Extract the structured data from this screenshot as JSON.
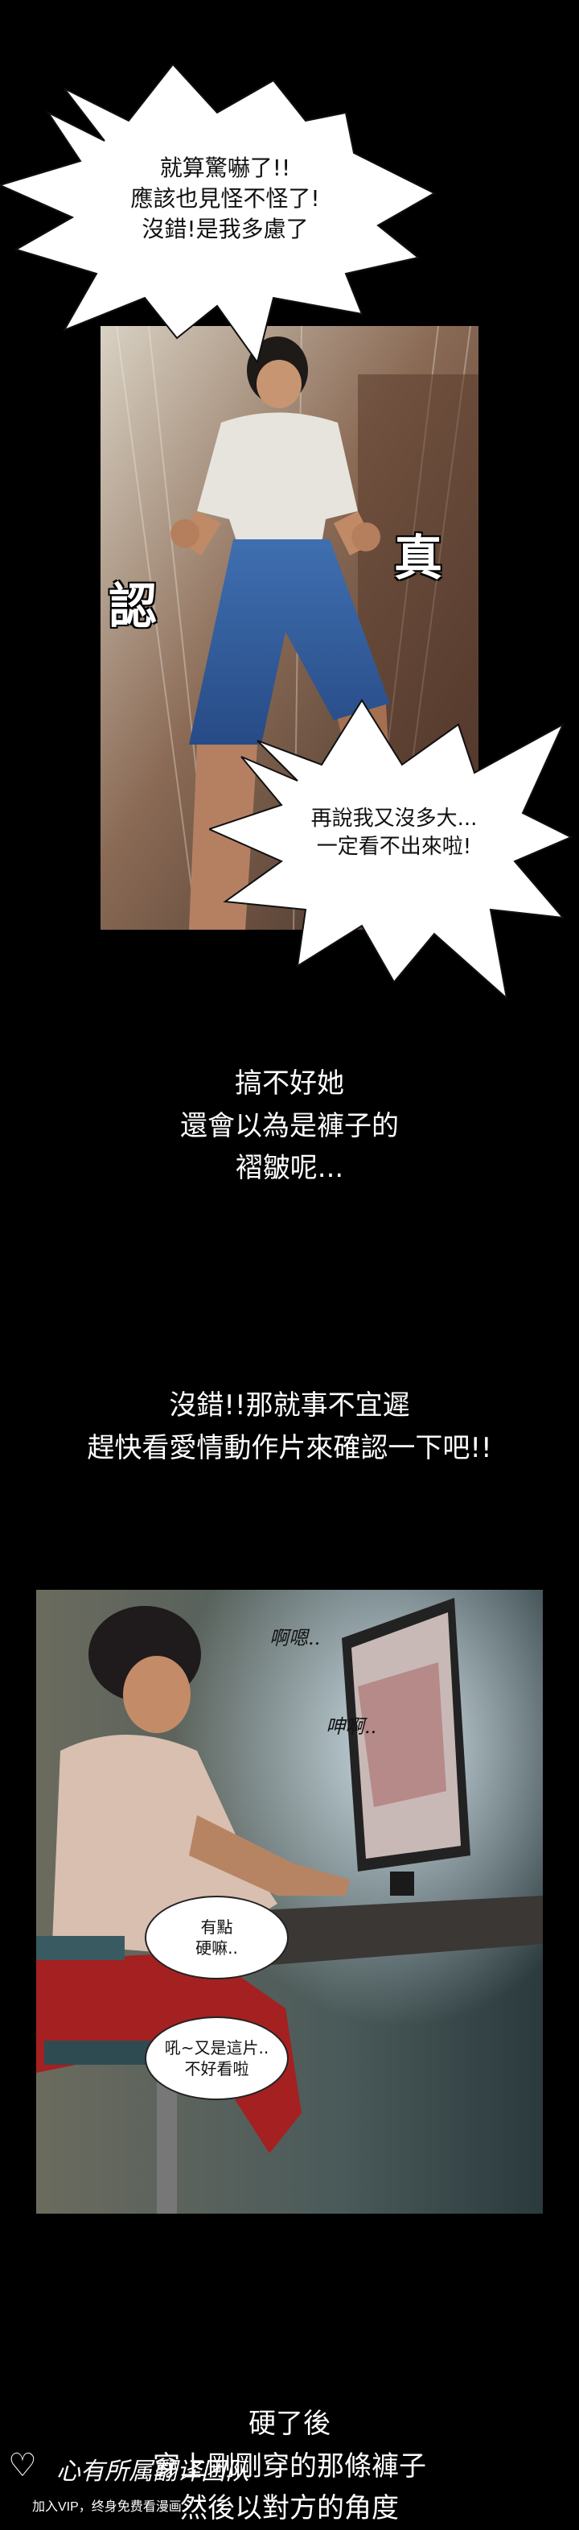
{
  "panel1": {
    "bubble_top": {
      "lines": [
        "就算驚嚇了!!",
        "應該也見怪不怪了!",
        "沒錯!是我多慮了"
      ]
    },
    "sfx_left": "認",
    "sfx_right": "真",
    "bubble_bottom": {
      "lines": [
        "再說我又沒多大...",
        "一定看不出來啦!"
      ]
    }
  },
  "narration1": {
    "lines": [
      "搞不好她",
      "還會以為是褲子的",
      "褶皺呢..."
    ]
  },
  "narration2": {
    "lines": [
      "沒錯!!那就事不宜遲",
      "趕快看愛情動作片來確認一下吧!!"
    ]
  },
  "panel2": {
    "sfx_1": "啊嗯..",
    "sfx_2": "呻啊..",
    "bubble_a": {
      "lines": [
        "有點",
        "硬嘛.."
      ]
    },
    "bubble_b": {
      "lines": [
        "吼~又是這片..",
        "不好看啦"
      ]
    }
  },
  "narration3": {
    "lines": [
      "硬了後",
      "穿上剛剛穿的那條褲子",
      "然後以對方的角度"
    ]
  },
  "watermark": {
    "text_main": "心有所属翻译团队",
    "text_sub": "加入VIP，终身免费看漫画"
  }
}
